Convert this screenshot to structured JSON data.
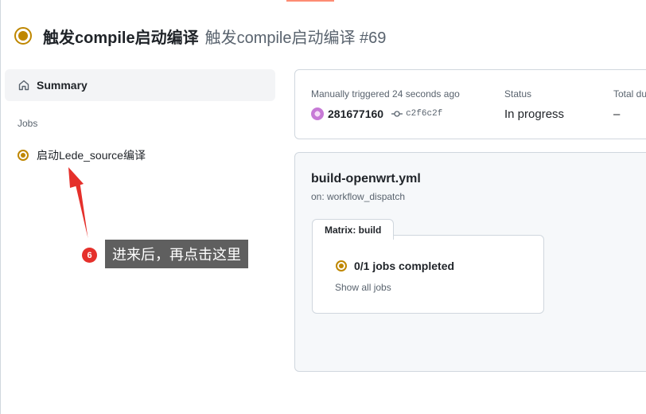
{
  "header": {
    "title_bold": "触发compile启动编译",
    "title_run": "触发compile启动编译 #69"
  },
  "sidebar": {
    "summary_label": "Summary",
    "jobs_heading": "Jobs",
    "jobs": [
      {
        "label": "启动Lede_source编译",
        "status": "in-progress"
      }
    ]
  },
  "annotation": {
    "step_number": "6",
    "text": "进来后，再点击这里"
  },
  "run_info": {
    "trigger_text": "Manually triggered 24 seconds ago",
    "actor": "281677160",
    "commit_sha": "c2f6c2f",
    "status_label": "Status",
    "status_value": "In progress",
    "duration_label": "Total duration",
    "duration_value": "–"
  },
  "workflow": {
    "file_name": "build-openwrt.yml",
    "trigger": "on: workflow_dispatch",
    "matrix_tab": "Matrix: build",
    "jobs_completed": "0/1 jobs completed",
    "show_all": "Show all jobs"
  },
  "colors": {
    "in_progress": "#bf8700",
    "accent": "#fd8c73",
    "annotation_badge": "#e5302b",
    "annotation_arrow": "#e5302b",
    "tooltip_bg": "#5f5f5f"
  }
}
